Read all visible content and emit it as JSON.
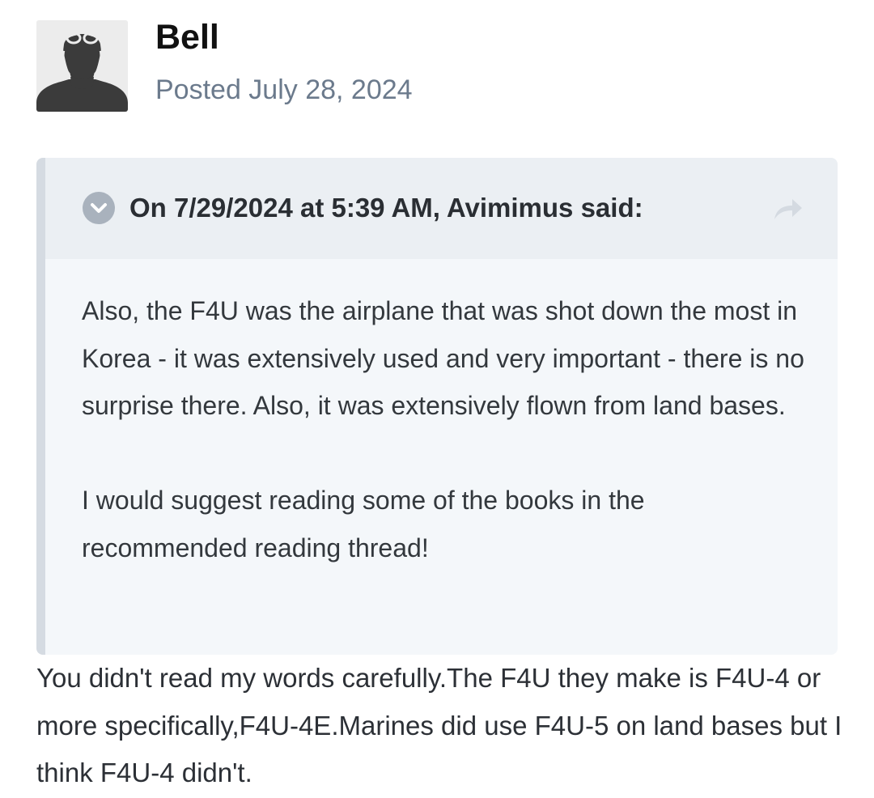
{
  "author": {
    "name": "Bell",
    "avatar_icon": "user-silhouette-icon"
  },
  "post": {
    "posted_label": "Posted July 28, 2024"
  },
  "quote": {
    "toggle_icon": "chevron-down-icon",
    "citation": "On 7/29/2024 at 5:39 AM, Avimimus said:",
    "jump_icon": "share-arrow-icon",
    "paragraphs": [
      "Also, the F4U was the airplane that was shot down the most in Korea - it was extensively used and very important - there is no surprise there. Also, it was extensively flown from land bases.",
      "I would suggest reading some of the books in the recommended reading thread!"
    ]
  },
  "reply": {
    "text": "You didn't read my words carefully.The F4U they make is F4U-4 or more specifically,F4U-4E.Marines did use F4U-5 on land bases but I think F4U-4 didn't."
  },
  "colors": {
    "quote_background": "#f4f7fa",
    "quote_header_background": "#ebeff3",
    "quote_border": "#d5dbe2",
    "meta_text": "#6b7a8c"
  }
}
